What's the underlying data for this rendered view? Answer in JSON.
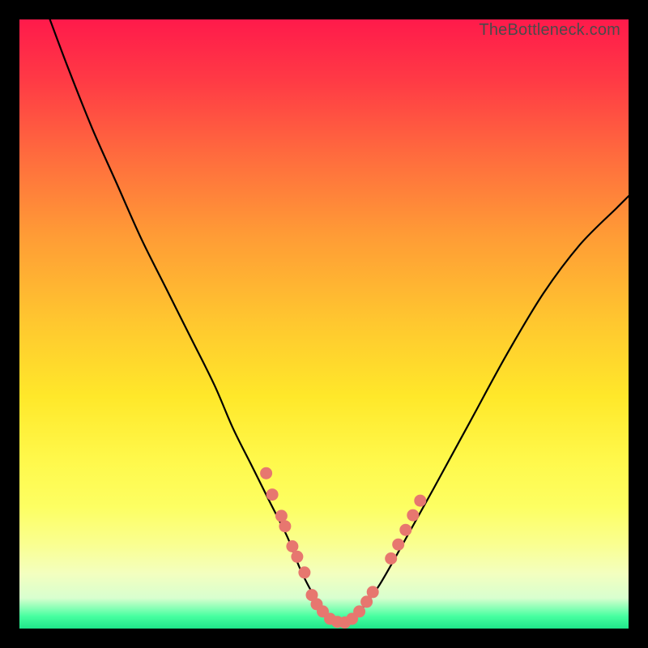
{
  "watermark": "TheBottleneck.com",
  "colors": {
    "dot": "#e7776f",
    "curve": "#000000"
  },
  "chart_data": {
    "type": "line",
    "title": "",
    "xlabel": "",
    "ylabel": "",
    "xlim": [
      0,
      100
    ],
    "ylim": [
      0,
      100
    ],
    "note": "Axis values are estimated from pixel positions; no numeric tick labels are visible in the image.",
    "series": [
      {
        "name": "curve",
        "x": [
          5,
          8,
          12,
          16,
          20,
          24,
          28,
          32,
          35,
          38,
          41,
          44,
          46,
          48,
          50,
          52,
          54,
          56,
          59,
          63,
          68,
          74,
          80,
          86,
          92,
          98,
          100
        ],
        "y": [
          100,
          92,
          82,
          73,
          64,
          56,
          48,
          40,
          33,
          27,
          21,
          15,
          10,
          6,
          3,
          1,
          1,
          3,
          7,
          14,
          23,
          34,
          45,
          55,
          63,
          69,
          71
        ]
      }
    ],
    "marker_clusters": [
      {
        "name": "left-cluster",
        "points": [
          {
            "x": 40.5,
            "y": 25.5
          },
          {
            "x": 41.5,
            "y": 22.0
          },
          {
            "x": 43.0,
            "y": 18.5
          },
          {
            "x": 43.6,
            "y": 16.8
          },
          {
            "x": 44.8,
            "y": 13.5
          },
          {
            "x": 45.6,
            "y": 11.8
          },
          {
            "x": 46.8,
            "y": 9.2
          }
        ]
      },
      {
        "name": "bottom-cluster",
        "points": [
          {
            "x": 48.0,
            "y": 5.5
          },
          {
            "x": 48.8,
            "y": 4.0
          },
          {
            "x": 49.8,
            "y": 2.8
          },
          {
            "x": 51.0,
            "y": 1.6
          },
          {
            "x": 52.2,
            "y": 1.1
          },
          {
            "x": 53.4,
            "y": 1.0
          },
          {
            "x": 54.6,
            "y": 1.6
          },
          {
            "x": 55.8,
            "y": 2.8
          },
          {
            "x": 57.0,
            "y": 4.4
          },
          {
            "x": 58.0,
            "y": 6.0
          }
        ]
      },
      {
        "name": "right-cluster",
        "points": [
          {
            "x": 61.0,
            "y": 11.5
          },
          {
            "x": 62.2,
            "y": 13.8
          },
          {
            "x": 63.4,
            "y": 16.2
          },
          {
            "x": 64.6,
            "y": 18.6
          },
          {
            "x": 65.8,
            "y": 21.0
          }
        ]
      }
    ]
  }
}
